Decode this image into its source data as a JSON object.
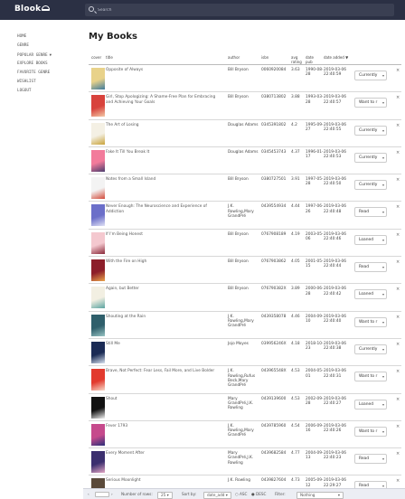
{
  "app": {
    "logo_text": "Blook",
    "search_placeholder": "Search"
  },
  "sidebar": {
    "items": [
      {
        "label": "HOME"
      },
      {
        "label": "GENRE"
      },
      {
        "label": "POPULAR GENRE",
        "caret": "▼"
      },
      {
        "label": "EXPLORE BOOKS"
      },
      {
        "label": "FAVORITE GENRE"
      },
      {
        "label": "WISHLIST"
      },
      {
        "label": "LOGOUT"
      }
    ]
  },
  "main": {
    "title": "My Books",
    "columns": {
      "cover": "cover",
      "title": "title",
      "author": "author",
      "isbn": "isbn",
      "rating": "avg rating",
      "pub": "date pub",
      "added": "date added",
      "added_sort": "▼"
    },
    "rows": [
      {
        "title": "Opposite of Always",
        "author": "Bill Bryson",
        "isbn": "0060920084",
        "rating": "3.63",
        "pub": "1990-08-28",
        "added": "2019-03-06 22:40:59",
        "shelf": "Currently",
        "cover_colors": [
          "#e8d28a",
          "#3d7a9c"
        ]
      },
      {
        "title": "Girl, Stop Apologizing: A Shame-Free Plan for Embracing and Achieving Your Goals",
        "author": "Bill Bryson",
        "isbn": "0380713802",
        "rating": "3.88",
        "pub": "1993-03-28",
        "added": "2019-03-06 22:40:57",
        "shelf": "Want to r",
        "cover_colors": [
          "#d8423c",
          "#f2c9a6"
        ]
      },
      {
        "title": "The Art of Losing",
        "author": "Douglas Adams",
        "isbn": "0345391802",
        "rating": "4.2",
        "pub": "1995-09-27",
        "added": "2019-03-06 22:40:55",
        "shelf": "Currently",
        "cover_colors": [
          "#f4f0e4",
          "#c9a33a"
        ]
      },
      {
        "title": "Fake It Till You Break It",
        "author": "Douglas Adams",
        "isbn": "0345453743",
        "rating": "4.37",
        "pub": "1996-01-17",
        "added": "2019-03-06 22:40:53",
        "shelf": "Currently",
        "cover_colors": [
          "#f27b9b",
          "#4b3d6e"
        ]
      },
      {
        "title": "Notes from a Small Island",
        "author": "Bill Bryson",
        "isbn": "0380727501",
        "rating": "3.91",
        "pub": "1997-05-28",
        "added": "2019-03-06 22:40:50",
        "shelf": "Currently",
        "cover_colors": [
          "#f3f3f3",
          "#d24a3a"
        ]
      },
      {
        "title": "Never Enough: The Neuroscience and Experience of Addiction",
        "author": "J.K. Rowling,Mary GrandPré",
        "isbn": "0439554934",
        "rating": "4.44",
        "pub": "1997-06-26",
        "added": "2019-03-06 22:40:48",
        "shelf": "Read",
        "cover_colors": [
          "#6b6fc9",
          "#dfe1f5"
        ]
      },
      {
        "title": "If I'm Being Honest",
        "author": "Bill Bryson",
        "isbn": "0767908189",
        "rating": "4.19",
        "pub": "2003-05-06",
        "added": "2019-03-06 22:40:46",
        "shelf": "Loaned",
        "cover_colors": [
          "#f4c8cf",
          "#8a2a3a"
        ]
      },
      {
        "title": "With the Fire on High",
        "author": "Bill Bryson",
        "isbn": "0767903862",
        "rating": "4.05",
        "pub": "2001-05-15",
        "added": "2019-03-06 22:40:44",
        "shelf": "Read",
        "cover_colors": [
          "#8c1e2a",
          "#e9a24a"
        ]
      },
      {
        "title": "Again, but Better",
        "author": "Bill Bryson",
        "isbn": "076790382X",
        "rating": "3.89",
        "pub": "2000-06-28",
        "added": "2019-03-06 22:40:42",
        "shelf": "Loaned",
        "cover_colors": [
          "#f2efe2",
          "#5aa3a0"
        ]
      },
      {
        "title": "Shouting at the Rain",
        "author": "J.K. Rowling,Mary GrandPré",
        "isbn": "0439358078",
        "rating": "4.46",
        "pub": "2004-09-10",
        "added": "2019-03-06 22:40:40",
        "shelf": "Want to r",
        "cover_colors": [
          "#2f5f6b",
          "#97c3c2"
        ]
      },
      {
        "title": "Still Me",
        "author": "Jojo Moyes",
        "isbn": "039956246X",
        "rating": "4.18",
        "pub": "2018-10-23",
        "added": "2019-03-06 22:40:38",
        "shelf": "Currently",
        "cover_colors": [
          "#1b2b55",
          "#d9e3f0"
        ]
      },
      {
        "title": "Brave, Not Perfect: Fear Less, Fail More, and Live Bolder",
        "author": "J.K. Rowling,Rufus Beck,Mary GrandPré",
        "isbn": "043965548X",
        "rating": "4.53",
        "pub": "2004-05-01",
        "added": "2019-03-06 22:40:31",
        "shelf": "Want to r",
        "cover_colors": [
          "#e23a2e",
          "#f6d9c9"
        ]
      },
      {
        "title": "Shout",
        "author": "Mary GrandPré,J.K. Rowling",
        "isbn": "0439139600",
        "rating": "4.53",
        "pub": "2002-09-28",
        "added": "2019-03-06 22:40:27",
        "shelf": "Loaned",
        "cover_colors": [
          "#121212",
          "#f2f2f2"
        ]
      },
      {
        "title": "Fever 1793",
        "author": "J.K. Rowling,Mary GrandPré",
        "isbn": "0439785960",
        "rating": "4.54",
        "pub": "2006-09-16",
        "added": "2019-03-06 22:40:26",
        "shelf": "Want to r",
        "cover_colors": [
          "#c64a8c",
          "#2b2f7a"
        ]
      },
      {
        "title": "Every Moment After",
        "author": "Mary GrandPré,J.K. Rowling",
        "isbn": "0439682584",
        "rating": "4.77",
        "pub": "2004-09-13",
        "added": "2019-03-06 22:40:23",
        "shelf": "Read",
        "cover_colors": [
          "#3b2f6e",
          "#e2a6c4"
        ]
      },
      {
        "title": "Serious Moonlight",
        "author": "J.K. Rowling",
        "isbn": "0439827604",
        "rating": "4.73",
        "pub": "2005-09-12",
        "added": "2019-03-06 22:29:27",
        "shelf": "Read",
        "cover_colors": [
          "#5a4a3a",
          "#e6d0a8"
        ]
      }
    ]
  },
  "footer": {
    "prev": "‹",
    "page_box": "",
    "next": "›",
    "rows_label": "Number of rows:",
    "rows_value": "25",
    "sort_label": "Sort by:",
    "sort_value": "date_add",
    "asc_label": "ASC",
    "desc_label": "DESC",
    "filter_label": "Filter:",
    "filter_value": "Nothing"
  },
  "colors": {
    "topbar": "#2b3044",
    "footer": "#eceef4"
  }
}
